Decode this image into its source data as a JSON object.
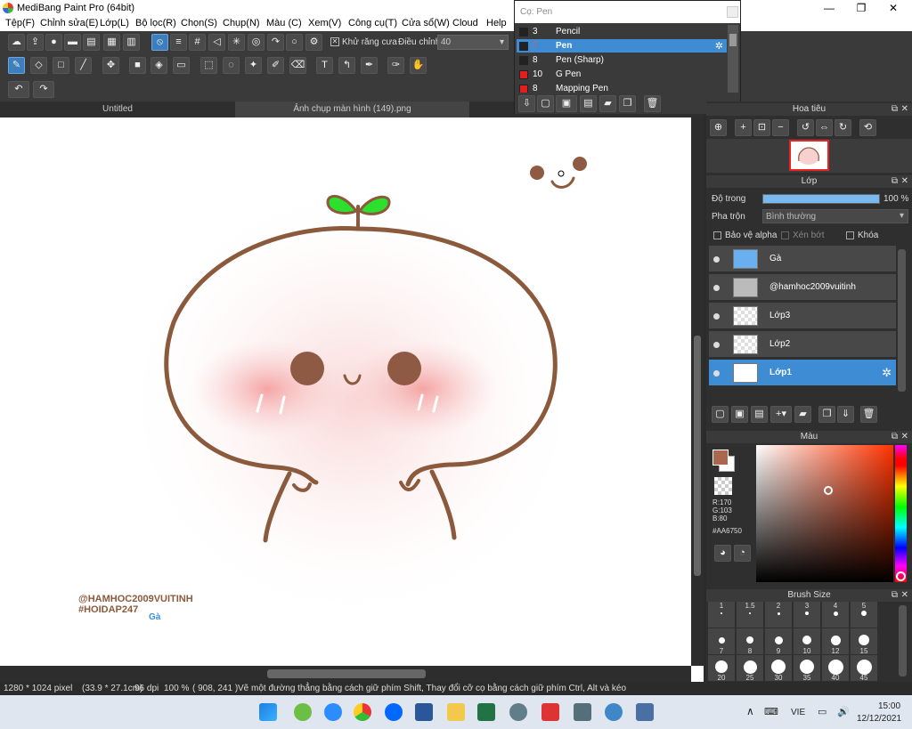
{
  "window": {
    "title": "MediBang Paint Pro (64bit)",
    "minimize": "—",
    "maximize": "❐",
    "close": "✕"
  },
  "menu": [
    "Tệp(F)",
    "Chỉnh sửa(E)",
    "Lớp(L)",
    "Bộ lọc(R)",
    "Chọn(S)",
    "Chụp(N)",
    "Màu (C)",
    "Xem(V)",
    "Công cụ(T)",
    "Cửa sổ(W)",
    "Cloud",
    "Help"
  ],
  "toolbar": {
    "antialias_label": "Khử răng cưa",
    "adjust_label": "Điều chỉnh",
    "adjust_value": "40"
  },
  "tabs": [
    "Untitled",
    "Ảnh chụp màn hình (149).png"
  ],
  "brush_panel": {
    "title": "Cọ: Pen",
    "items": [
      {
        "num": "3",
        "name": "Pencil",
        "color": "#222222"
      },
      {
        "num": "7",
        "name": "Pen",
        "color": "#222222",
        "selected": true
      },
      {
        "num": "8",
        "name": "Pen (Sharp)",
        "color": "#222222"
      },
      {
        "num": "10",
        "name": "G Pen",
        "color": "#e02020"
      },
      {
        "num": "8",
        "name": "Mapping Pen",
        "color": "#e02020"
      }
    ]
  },
  "navigator": {
    "title": "Hoa tiêu"
  },
  "layers": {
    "title": "Lớp",
    "opacity_label": "Độ trong",
    "opacity_value": "100 %",
    "opacity_fraction": 1.0,
    "blend_label": "Pha trộn",
    "blend_value": "Bình thường",
    "protect_alpha": "Bảo vệ alpha",
    "clipping": "Xén bớt",
    "lock": "Khóa",
    "items": [
      {
        "name": "Gà"
      },
      {
        "name": "@hamhoc2009vuitinh"
      },
      {
        "name": "Lớp3"
      },
      {
        "name": "Lớp2"
      },
      {
        "name": "Lớp1",
        "selected": true
      }
    ]
  },
  "color_panel": {
    "title": "Màu",
    "r": "R:170",
    "g": "G:103",
    "b": "B:80",
    "hex": "#AA6750",
    "current": "#AA6750"
  },
  "brush_size": {
    "title": "Brush Size",
    "sizes": [
      "1",
      "1.5",
      "2",
      "3",
      "4",
      "5",
      "7",
      "8",
      "9",
      "10",
      "12",
      "15",
      "20",
      "25",
      "30",
      "35",
      "40",
      "45"
    ]
  },
  "canvas": {
    "watermark1": "@HAMHOC2009VUITINH",
    "watermark2": "#HOIDAP247",
    "watermark3": "Gà"
  },
  "status": {
    "size": "1280 * 1024 pixel",
    "cm": "(33.9 * 27.1cm)",
    "dpi": "96 dpi",
    "zoom": "100 %",
    "coords": "( 908, 241 )",
    "hint": "Vẽ một đường thẳng bằng cách giữ phím Shift, Thay đổi cỡ cọ bằng cách giữ phím Ctrl, Alt và kéo"
  },
  "taskbar": {
    "lang": "VIE",
    "time": "15:00",
    "date": "12/12/2021"
  }
}
